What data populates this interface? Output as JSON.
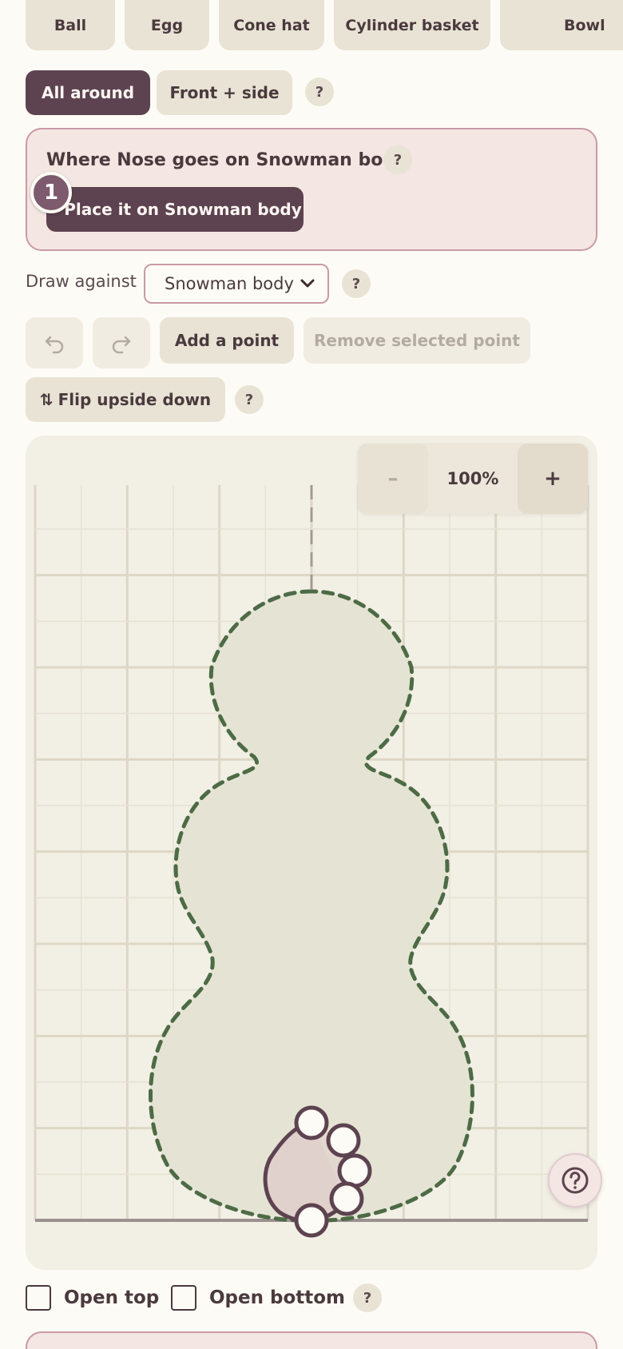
{
  "shape_tiles": [
    {
      "label": "Ball"
    },
    {
      "label": "Egg"
    },
    {
      "label": "Cone hat"
    },
    {
      "label": "Cylinder basket"
    },
    {
      "label": "Bowl"
    }
  ],
  "mode": {
    "all_around": "All around",
    "front_side": "Front + side",
    "help": "?"
  },
  "placement_panel": {
    "title": "Where Nose goes on Snowman body",
    "help": "?",
    "step_number": "1",
    "button_label": "Place it on Snowman body"
  },
  "draw_against": {
    "label": "Draw against",
    "selected": "Snowman body",
    "help": "?"
  },
  "edit_toolbar": {
    "undo_icon": "undo-icon",
    "redo_icon": "redo-icon",
    "add_point": "Add a point",
    "remove_point": "Remove selected point"
  },
  "flip": {
    "label": "Flip upside down",
    "icon": "⇅",
    "help": "?"
  },
  "zoom": {
    "out": "–",
    "level": "100%",
    "in": "+"
  },
  "options": {
    "open_top": "Open top",
    "open_bottom": "Open bottom",
    "help": "?"
  },
  "colors": {
    "accent_dark": "#5d4350",
    "reference_outline": "#4d6b45",
    "shape_outline": "#5d4350",
    "panel_bg": "#f4e6e2"
  }
}
